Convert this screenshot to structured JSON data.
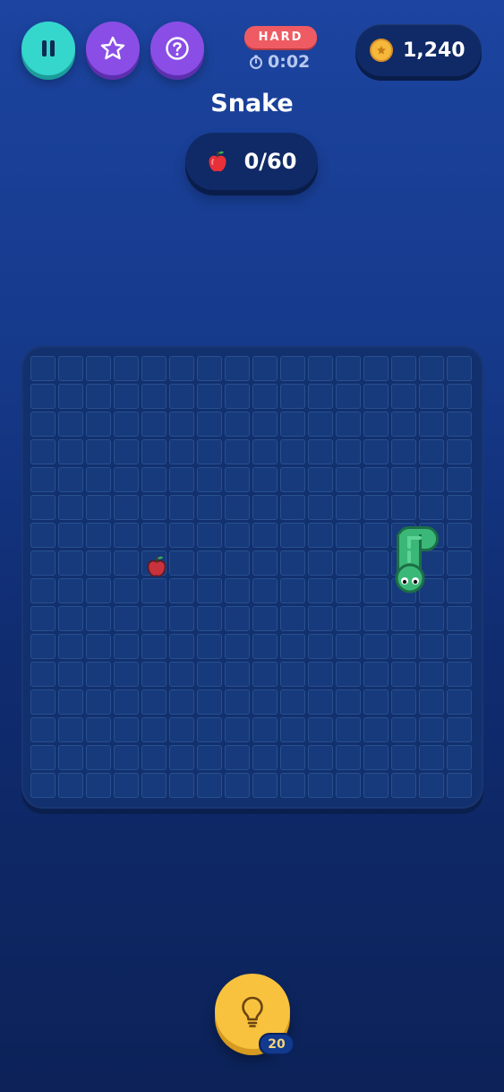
{
  "header": {
    "difficulty": "HARD",
    "timer": "0:02",
    "coins": "1,240"
  },
  "title": "Snake",
  "progress": {
    "eaten": 0,
    "goal": 60,
    "label": "0/60"
  },
  "board": {
    "columns": 16,
    "rows": 16,
    "snake_cells": [
      [
        13,
        6
      ],
      [
        14,
        6
      ],
      [
        13,
        7
      ],
      [
        13,
        8
      ]
    ],
    "snake_head": [
      13,
      8
    ],
    "food_cell": [
      4,
      7
    ]
  },
  "hint": {
    "count": "20"
  },
  "icons": {
    "pause": "pause-icon",
    "star": "star-icon",
    "help": "question-icon",
    "timer": "stopwatch-icon",
    "coin": "coin-icon",
    "fruit": "apple-icon",
    "hint": "lightbulb-icon"
  },
  "colors": {
    "pause_button": "#35d6cc",
    "purple_button": "#8a4ee6",
    "difficulty_badge": "#ef5b63",
    "snake": "#3bb878",
    "hint_button": "#f8c23e"
  }
}
